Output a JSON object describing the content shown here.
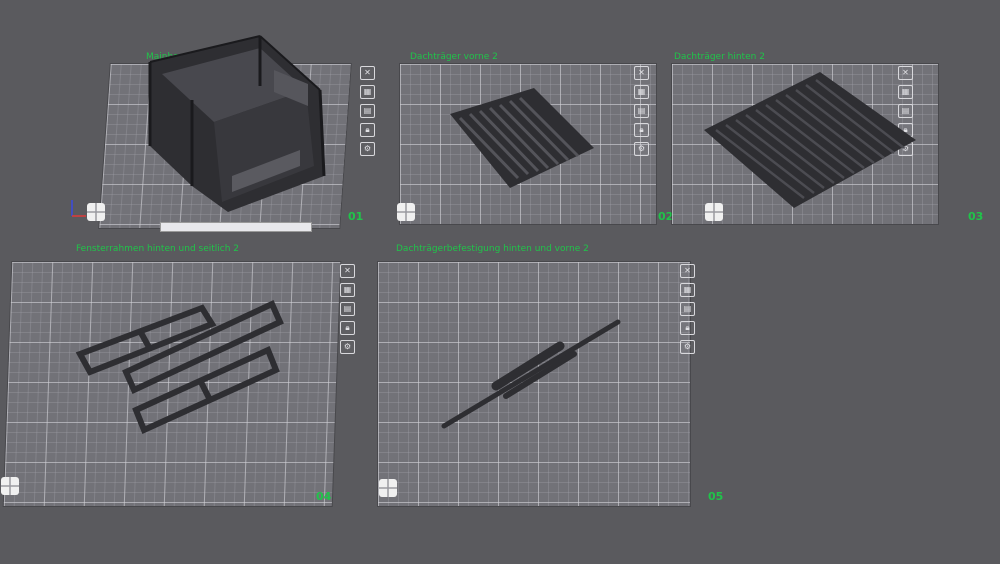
{
  "plates": [
    {
      "label": "Mainbox  01",
      "number": "01"
    },
    {
      "label": "Dachträger vorne 2",
      "number": "02"
    },
    {
      "label": "Dachträger hinten 2",
      "number": "03"
    },
    {
      "label": "Fensterrahmen hinten und seitlich 2",
      "number": "04"
    },
    {
      "label": "Dachträgerbefestigung hinten und vorne 2",
      "number": "05"
    }
  ],
  "tool_icons": [
    "close-icon",
    "arrange-icon",
    "orient-icon",
    "lock-icon",
    "settings-icon"
  ],
  "colors": {
    "background": "#5a5a5e",
    "plate": "#727278",
    "label_green": "#20c44a",
    "model": "#2e2e32"
  }
}
